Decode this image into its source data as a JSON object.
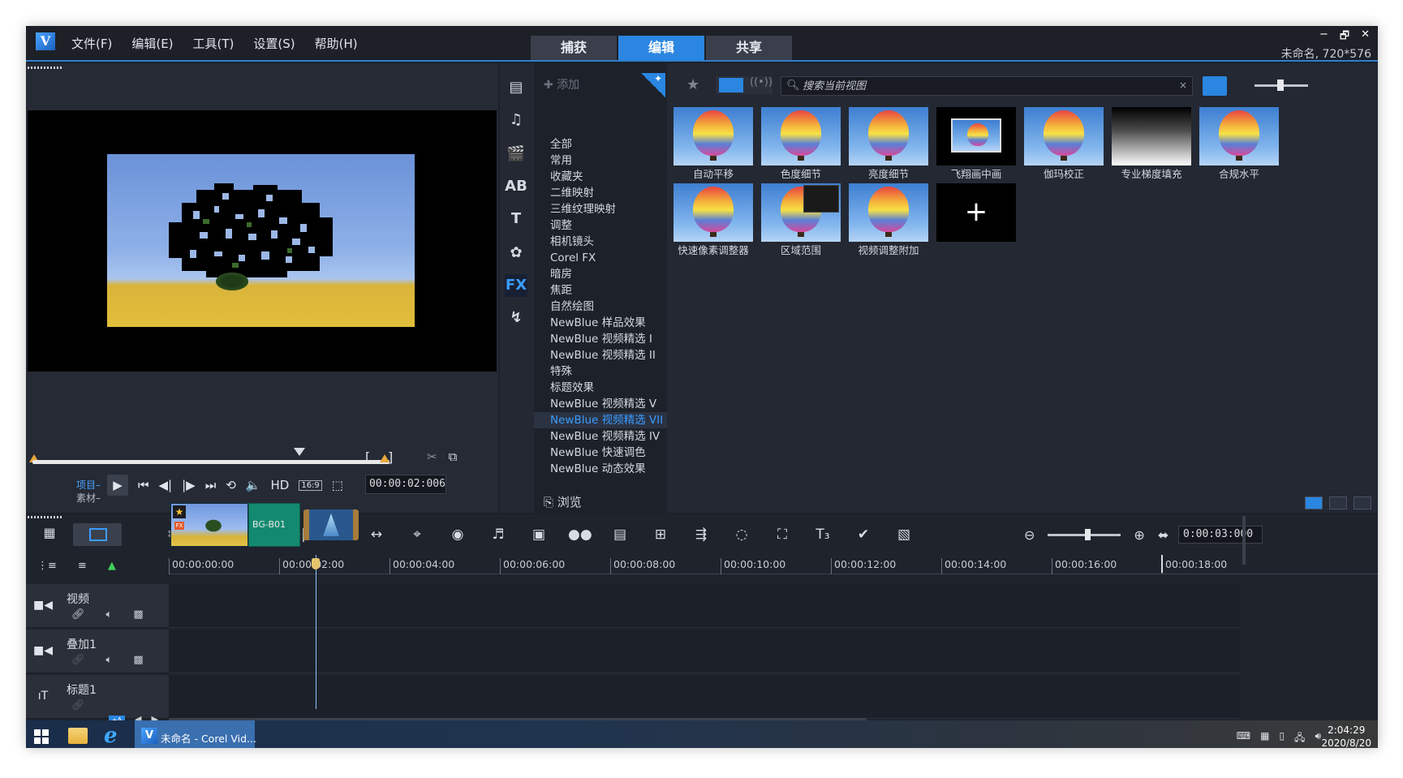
{
  "app": {
    "logo": "V",
    "menu": [
      "文件(F)",
      "编辑(E)",
      "工具(T)",
      "设置(S)",
      "帮助(H)"
    ],
    "mode_tabs": [
      "捕获",
      "编辑",
      "共享"
    ],
    "active_mode": "编辑",
    "window_controls": [
      "−",
      "🗗",
      "✕"
    ],
    "project_info": "未命名, 720*576"
  },
  "preview": {
    "mark_in": "[",
    "mark_out": "]",
    "mode_project": "项目",
    "mode_clip": "素材",
    "hd_label": "HD",
    "aspect_label": "16:9",
    "timecode": "00:00:02:006"
  },
  "library": {
    "add_label": "添加",
    "categories": [
      "全部",
      "常用",
      "收藏夹",
      "二维映射",
      "三维纹理映射",
      "调整",
      "相机镜头",
      "Corel FX",
      "暗房",
      "焦距",
      "自然绘图",
      "NewBlue 样品效果",
      "NewBlue 视频精选 I",
      "NewBlue 视频精选 II",
      "特殊",
      "标题效果",
      "NewBlue 视频精选 V",
      "NewBlue 视频精选 VII",
      "NewBlue 视频精选 IV",
      "NewBlue 快速调色",
      "NewBlue 动态效果"
    ],
    "selected_category": "NewBlue 视频精选 VII",
    "browse_label": "浏览",
    "search_placeholder": "搜索当前视图",
    "thumbnails": [
      {
        "label": "自动平移",
        "kind": "balloon"
      },
      {
        "label": "色度细节",
        "kind": "balloon"
      },
      {
        "label": "亮度细节",
        "kind": "balloon"
      },
      {
        "label": "飞翔画中画",
        "kind": "pip"
      },
      {
        "label": "伽玛校正",
        "kind": "balloon"
      },
      {
        "label": "专业梯度填充",
        "kind": "gradient"
      },
      {
        "label": "合规水平",
        "kind": "balloon"
      },
      {
        "label": "快速像素调整器",
        "kind": "balloon"
      },
      {
        "label": "区域范围",
        "kind": "balloon-scope"
      },
      {
        "label": "视频调整附加",
        "kind": "balloon"
      },
      {
        "label": "",
        "kind": "add"
      }
    ],
    "add_tile_symbol": "+"
  },
  "timeline": {
    "project_duration": "0:00:03:000",
    "ruler_ticks": [
      "00:00:00:00",
      "00:00:02:00",
      "00:00:04:00",
      "00:00:06:00",
      "00:00:08:00",
      "00:00:10:00",
      "00:00:12:00",
      "00:00:14:00",
      "00:00:16:00",
      "00:00:18:00"
    ],
    "tracks": [
      {
        "name": "视频",
        "icon": "video-track-icon"
      },
      {
        "name": "叠加1",
        "icon": "overlay-track-icon"
      },
      {
        "name": "标题1",
        "icon": "title-track-icon"
      }
    ],
    "clips": {
      "bg_label": "BG-B01",
      "fx_badge": "FX",
      "star": "★"
    }
  },
  "taskbar": {
    "app_label": "未命名 - Corel Vid...",
    "time": "2:04:29",
    "date": "2020/8/20"
  },
  "colors": {
    "accent": "#2a86e0",
    "background": "#1c2029",
    "panel": "#232833",
    "selected_text": "#3a9cff"
  }
}
